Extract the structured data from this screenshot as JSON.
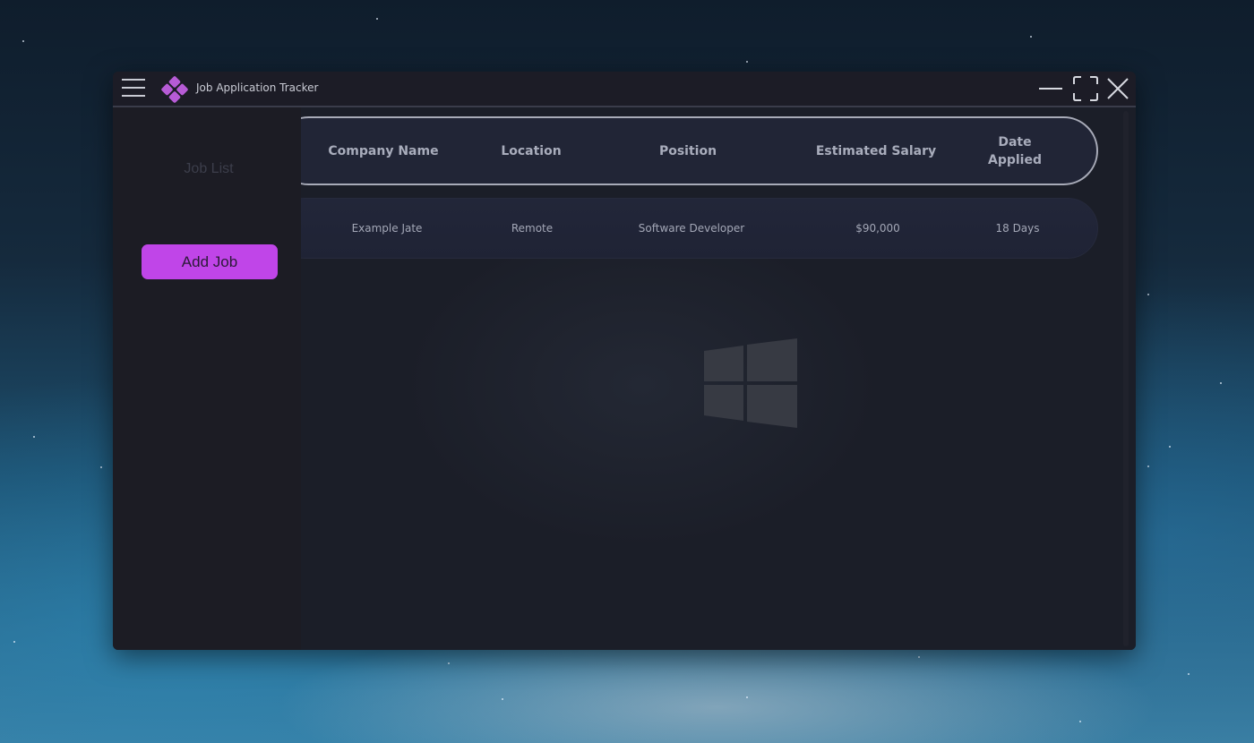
{
  "window": {
    "title": "Job Application Tracker",
    "accent_color": "#c045e8"
  },
  "titlebar_icons": {
    "menu": "hamburger-menu-icon",
    "logo": "diamond-logo-icon",
    "minimize": "minimize-icon",
    "maximize": "maximize-icon",
    "close": "close-icon"
  },
  "sidebar": {
    "nav_job_list": "Job List",
    "add_job_label": "Add Job"
  },
  "table": {
    "headers": [
      "Company Name",
      "Location",
      "Position",
      "Estimated Salary",
      "Date Applied"
    ],
    "rows": [
      [
        "Example Jate",
        "Remote",
        "Software Developer",
        "$90,000",
        "18 Days"
      ]
    ]
  }
}
